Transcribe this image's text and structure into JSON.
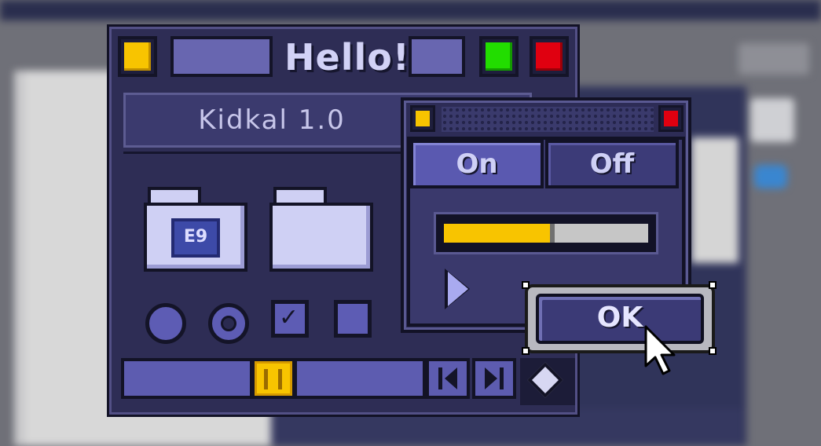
{
  "window": {
    "title": "Hello!",
    "header_title": "Kidkal 1.0",
    "folder_badge_text": "E9"
  },
  "controls": {
    "radio_1": "filled",
    "radio_2": "selected",
    "checkbox_1": "checked",
    "checkbox_2": "unchecked"
  },
  "scrollbar": {
    "left_arrow_icon": "triangle-left-icon",
    "right_arrow_icon": "triangle-right-icon"
  },
  "dialog": {
    "tabs": [
      {
        "label": "On",
        "active": true
      },
      {
        "label": "Off",
        "active": false
      }
    ],
    "progress": 0.52,
    "ok_label": "OK"
  },
  "colors": {
    "accent_yellow": "#f8c400",
    "green": "#22dd00",
    "red": "#e00010",
    "window_bg": "#2e2d55"
  }
}
